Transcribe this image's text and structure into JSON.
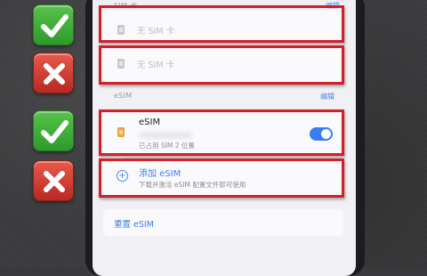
{
  "screen": {
    "top_label": "SIM 卡",
    "top_edit": "编辑",
    "sim_slot_1": "无 SIM 卡",
    "sim_slot_2": "无 SIM 卡",
    "esim_section_label": "eSIM",
    "esim_edit": "编辑",
    "esim_item": {
      "title": "eSIM",
      "subtitle": "已占用 SIM 2 位置",
      "toggle_on": true
    },
    "add_esim": {
      "title": "添加 eSIM",
      "subtitle": "下载并激活 eSIM 配置文件即可使用"
    },
    "reset_esim": "重置 eSIM"
  },
  "indicators": [
    {
      "type": "check",
      "icon": "checkmark-icon"
    },
    {
      "type": "cross",
      "icon": "cross-icon"
    },
    {
      "type": "check",
      "icon": "checkmark-icon"
    },
    {
      "type": "cross",
      "icon": "cross-icon"
    }
  ],
  "colors": {
    "highlight_box": "#d41e28",
    "check_green": "#3cae36",
    "cross_red": "#cf3a30",
    "accent_blue": "#3b7cf2"
  }
}
